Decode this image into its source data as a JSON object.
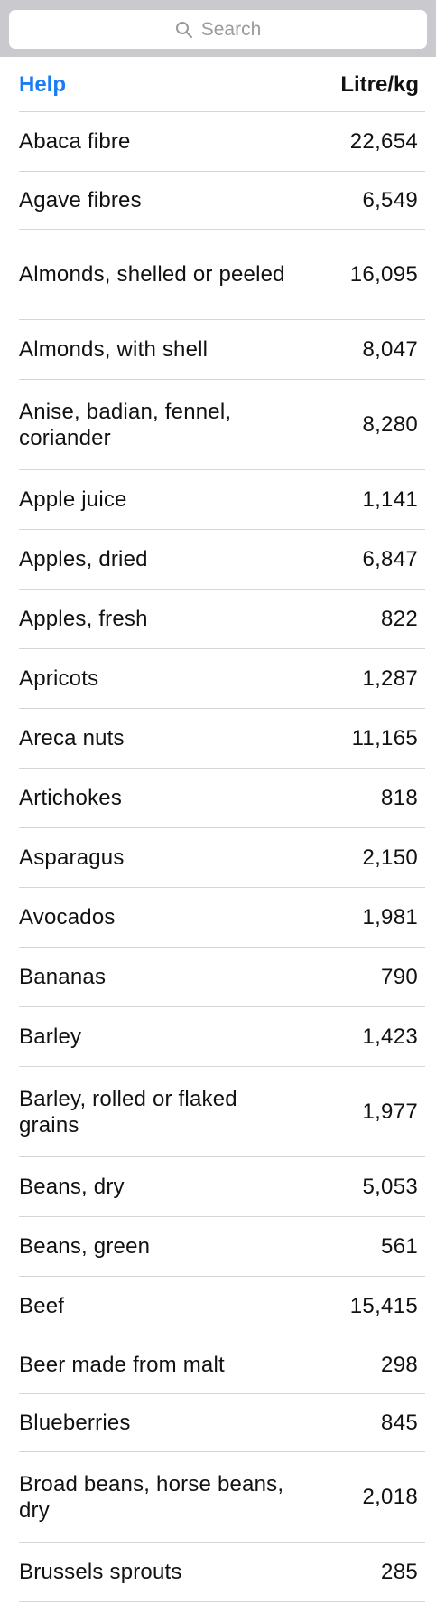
{
  "search": {
    "placeholder": "Search"
  },
  "header": {
    "help_label": "Help",
    "unit_label": "Litre/kg"
  },
  "items": [
    {
      "name": "Abaca fibre",
      "value": "22,654"
    },
    {
      "name": "Agave fibres",
      "value": "6,549"
    },
    {
      "name": "Almonds, shelled or peeled",
      "value": "16,095"
    },
    {
      "name": "Almonds, with shell",
      "value": "8,047"
    },
    {
      "name": "Anise, badian, fennel, coriander",
      "value": "8,280"
    },
    {
      "name": "Apple juice",
      "value": "1,141"
    },
    {
      "name": "Apples, dried",
      "value": "6,847"
    },
    {
      "name": "Apples, fresh",
      "value": "822"
    },
    {
      "name": "Apricots",
      "value": "1,287"
    },
    {
      "name": "Areca nuts",
      "value": "11,165"
    },
    {
      "name": "Artichokes",
      "value": "818"
    },
    {
      "name": "Asparagus",
      "value": "2,150"
    },
    {
      "name": "Avocados",
      "value": "1,981"
    },
    {
      "name": "Bananas",
      "value": "790"
    },
    {
      "name": "Barley",
      "value": "1,423"
    },
    {
      "name": "Barley, rolled or flaked grains",
      "value": "1,977"
    },
    {
      "name": "Beans, dry",
      "value": "5,053"
    },
    {
      "name": "Beans, green",
      "value": "561"
    },
    {
      "name": "Beef",
      "value": "15,415"
    },
    {
      "name": "Beer made from malt",
      "value": "298"
    },
    {
      "name": "Blueberries",
      "value": "845"
    },
    {
      "name": "Broad beans, horse beans, dry",
      "value": "2,018"
    },
    {
      "name": "Brussels sprouts",
      "value": "285"
    }
  ]
}
